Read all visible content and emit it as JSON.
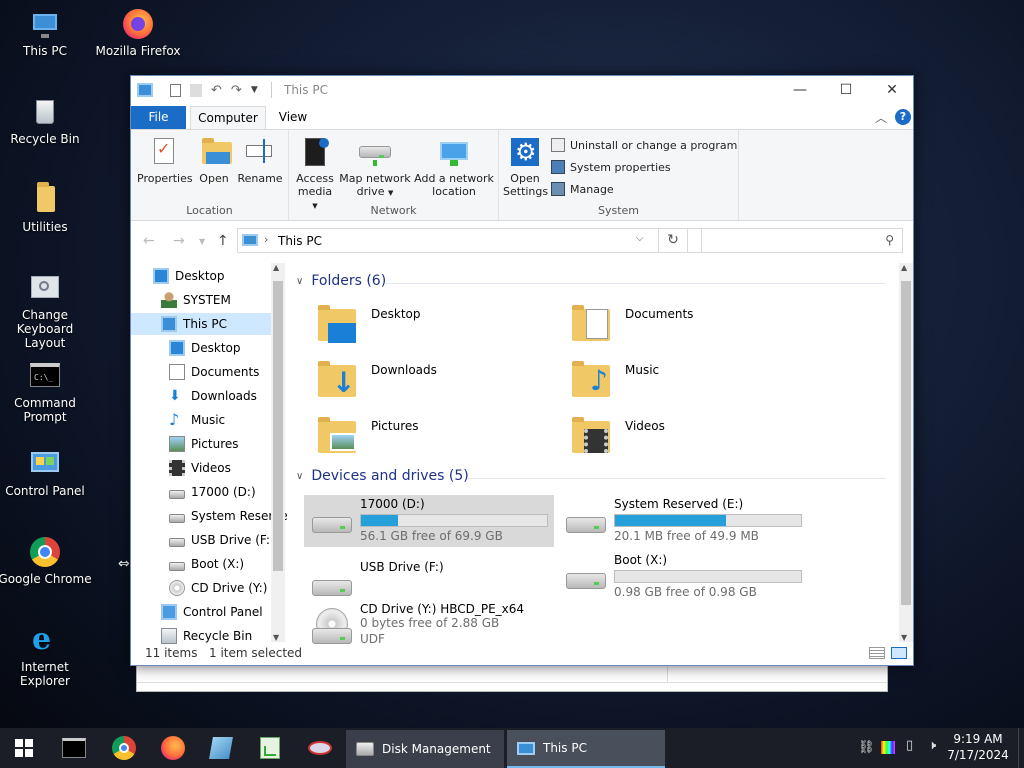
{
  "desktop": {
    "icons": [
      {
        "label": "This PC",
        "icon": "computer-icon"
      },
      {
        "label": "Mozilla Firefox",
        "icon": "firefox-icon"
      },
      {
        "label": "Recycle Bin",
        "icon": "recycle-bin-icon"
      },
      {
        "label": "Utilities",
        "icon": "folder-icon"
      },
      {
        "label": "Change Keyboard Layout",
        "icon": "keyboard-icon"
      },
      {
        "label": "Command Prompt",
        "icon": "cmd-icon"
      },
      {
        "label": "Control Panel",
        "icon": "control-panel-icon"
      },
      {
        "label": "Google Chrome",
        "icon": "chrome-icon"
      },
      {
        "label": "Internet Explorer",
        "icon": "ie-icon"
      }
    ]
  },
  "window": {
    "title": "This PC",
    "tabs": [
      "File",
      "Computer",
      "View"
    ],
    "ribbon": {
      "location": {
        "label": "Location",
        "buttons": [
          "Properties",
          "Open",
          "Rename"
        ]
      },
      "network": {
        "label": "Network",
        "buttons": [
          "Access media",
          "Map network drive",
          "Add a network location"
        ],
        "access_line1": "Access",
        "access_line2": "media",
        "map_line1": "Map network",
        "map_line2": "drive",
        "add_line1": "Add a network",
        "add_line2": "location"
      },
      "system": {
        "label": "System",
        "open_line1": "Open",
        "open_line2": "Settings",
        "items": [
          "Uninstall or change a program",
          "System properties",
          "Manage"
        ]
      }
    },
    "address": {
      "path": "This PC"
    },
    "nav_pane": [
      {
        "label": "Desktop",
        "icon": "desktop-icon",
        "level": 0
      },
      {
        "label": "SYSTEM",
        "icon": "user-icon",
        "level": 1
      },
      {
        "label": "This PC",
        "icon": "computer-icon",
        "level": 1,
        "selected": true
      },
      {
        "label": "Desktop",
        "icon": "desktop-icon",
        "level": 2
      },
      {
        "label": "Documents",
        "icon": "documents-icon",
        "level": 2
      },
      {
        "label": "Downloads",
        "icon": "downloads-icon",
        "level": 2
      },
      {
        "label": "Music",
        "icon": "music-icon",
        "level": 2
      },
      {
        "label": "Pictures",
        "icon": "pictures-icon",
        "level": 2
      },
      {
        "label": "Videos",
        "icon": "videos-icon",
        "level": 2
      },
      {
        "label": "17000 (D:)",
        "icon": "drive-icon",
        "level": 2
      },
      {
        "label": "System Reserve",
        "icon": "drive-icon",
        "level": 2
      },
      {
        "label": "USB Drive (F:)",
        "icon": "drive-icon",
        "level": 2
      },
      {
        "label": "Boot (X:)",
        "icon": "drive-icon",
        "level": 2
      },
      {
        "label": "CD Drive (Y:) H",
        "icon": "cd-drive-icon",
        "level": 2
      },
      {
        "label": "Control Panel",
        "icon": "control-panel-icon",
        "level": 1
      },
      {
        "label": "Recycle Bin",
        "icon": "recycle-bin-icon",
        "level": 1
      }
    ],
    "folders_header": "Folders (6)",
    "folders": [
      "Desktop",
      "Documents",
      "Downloads",
      "Music",
      "Pictures",
      "Videos"
    ],
    "drives_header": "Devices and drives (5)",
    "drives": [
      {
        "name": "17000 (D:)",
        "free": "56.1 GB free of 69.9 GB",
        "used_pct": 19.7,
        "selected": true
      },
      {
        "name": "System Reserved (E:)",
        "free": "20.1 MB free of 49.9 MB",
        "used_pct": 59.7
      },
      {
        "name": "USB Drive (F:)",
        "free": "",
        "used_pct": null
      },
      {
        "name": "Boot (X:)",
        "free": "0.98 GB free of 0.98 GB",
        "used_pct": 0
      },
      {
        "name": "CD Drive (Y:) HBCD_PE_x64",
        "free": "0 bytes free of 2.88 GB",
        "used_pct": null,
        "extra": "UDF"
      }
    ],
    "status": {
      "count": "11 items",
      "selected": "1 item selected"
    }
  },
  "taskbar": {
    "apps": [
      {
        "label": "Disk Management",
        "icon": "disk-management-icon"
      },
      {
        "label": "This PC",
        "icon": "computer-icon",
        "active": true
      }
    ],
    "time": "9:19 AM",
    "date": "7/17/2024"
  },
  "colors": {
    "accent": "#1a6cc7",
    "drive_bar": "#26a0da",
    "taskbar": "#1b1e27"
  }
}
